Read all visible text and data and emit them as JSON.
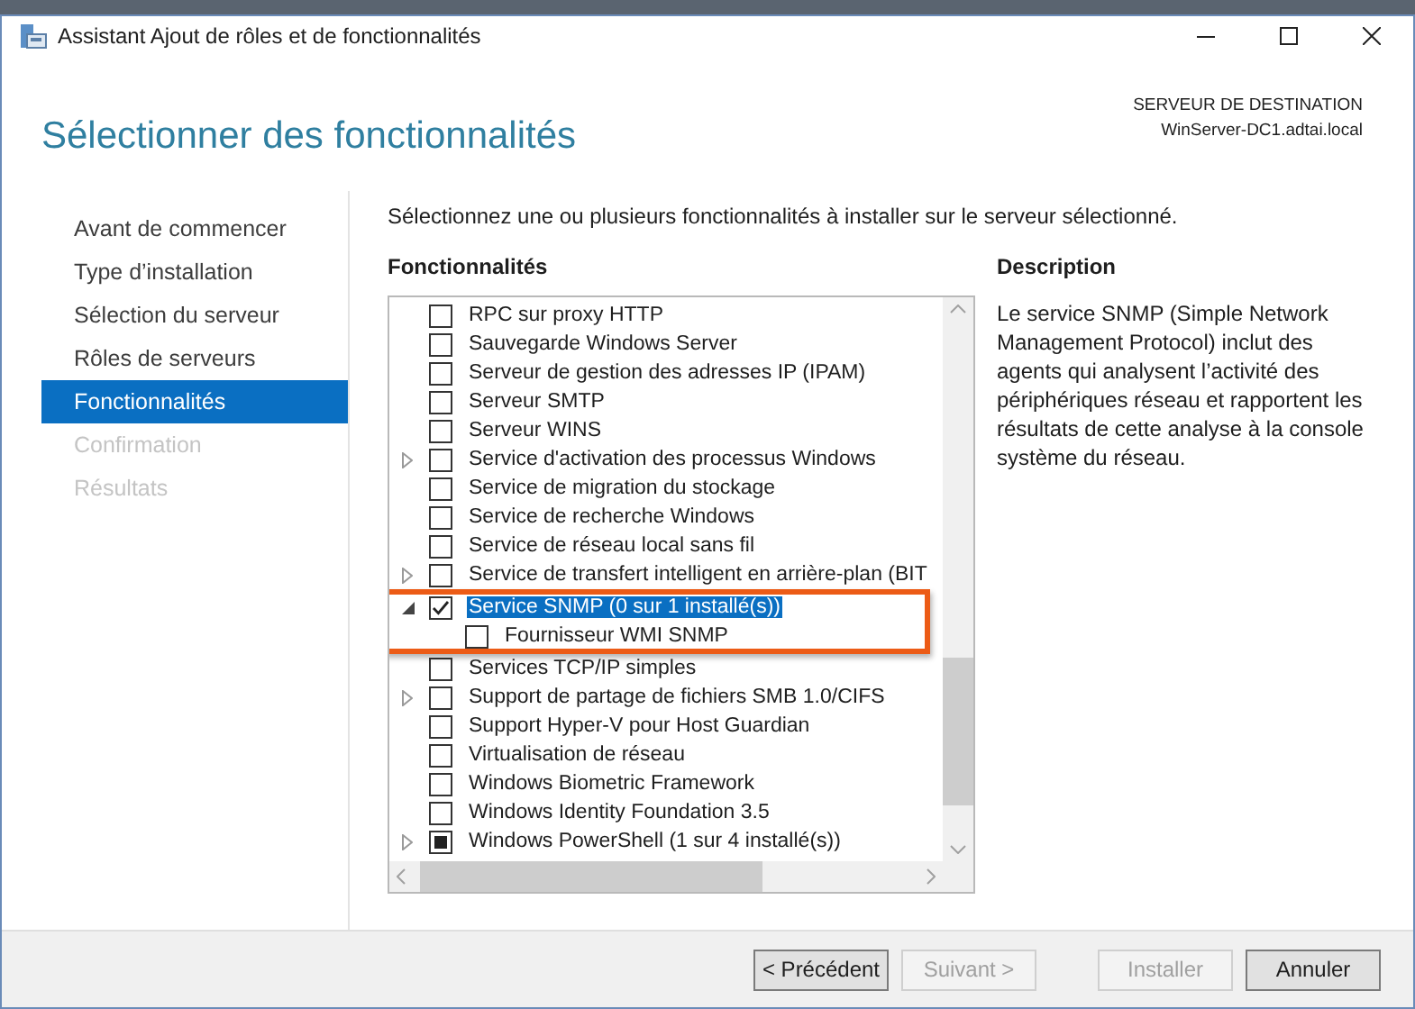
{
  "window": {
    "title": "Assistant Ajout de rôles et de fonctionnalités"
  },
  "header": {
    "title": "Sélectionner des fonctionnalités",
    "destination_label": "SERVEUR DE DESTINATION",
    "destination_server": "WinServer-DC1.adtai.local"
  },
  "nav": [
    {
      "label": "Avant de commencer",
      "selected": false,
      "disabled": false
    },
    {
      "label": "Type d’installation",
      "selected": false,
      "disabled": false
    },
    {
      "label": "Sélection du serveur",
      "selected": false,
      "disabled": false
    },
    {
      "label": "Rôles de serveurs",
      "selected": false,
      "disabled": false
    },
    {
      "label": "Fonctionnalités",
      "selected": true,
      "disabled": false
    },
    {
      "label": "Confirmation",
      "selected": false,
      "disabled": true
    },
    {
      "label": "Résultats",
      "selected": false,
      "disabled": true
    }
  ],
  "instruction": "Sélectionnez une ou plusieurs fonctionnalités à installer sur le serveur sélectionné.",
  "features_heading": "Fonctionnalités",
  "features": [
    {
      "label": "RPC sur proxy HTTP",
      "checked": false,
      "selected": false
    },
    {
      "label": "Sauvegarde Windows Server",
      "checked": false,
      "selected": false
    },
    {
      "label": "Serveur de gestion des adresses IP (IPAM)",
      "checked": false,
      "selected": false
    },
    {
      "label": "Serveur SMTP",
      "checked": false,
      "selected": false
    },
    {
      "label": "Serveur WINS",
      "checked": false,
      "selected": false
    },
    {
      "label": "Service d'activation des processus Windows",
      "checked": false,
      "expanded": false,
      "selected": false
    },
    {
      "label": "Service de migration du stockage",
      "checked": false,
      "selected": false
    },
    {
      "label": "Service de recherche Windows",
      "checked": false,
      "selected": false
    },
    {
      "label": "Service de réseau local sans fil",
      "checked": false,
      "selected": false
    },
    {
      "label": "Service de transfert intelligent en arrière-plan (BIT",
      "checked": false,
      "expanded": false,
      "selected": false
    },
    {
      "label": "Service SNMP (0 sur 1 installé(s))",
      "checked": true,
      "expanded": true,
      "selected": true,
      "highlighted": true,
      "children": [
        {
          "label": "Fournisseur WMI SNMP",
          "checked": false,
          "selected": false
        }
      ]
    },
    {
      "label": "Services TCP/IP simples",
      "checked": false,
      "selected": false
    },
    {
      "label": "Support de partage de fichiers SMB 1.0/CIFS",
      "checked": false,
      "expanded": false,
      "selected": false
    },
    {
      "label": "Support Hyper-V pour Host Guardian",
      "checked": false,
      "selected": false
    },
    {
      "label": "Virtualisation de réseau",
      "checked": false,
      "selected": false
    },
    {
      "label": "Windows Biometric Framework",
      "checked": false,
      "selected": false
    },
    {
      "label": "Windows Identity Foundation 3.5",
      "checked": false,
      "selected": false
    },
    {
      "label": "Windows PowerShell (1 sur 4 installé(s))",
      "checked": false,
      "partial": true,
      "expanded": false,
      "selected": false
    }
  ],
  "description_heading": "Description",
  "description": "Le service SNMP (Simple Network Management Protocol) inclut des agents qui analysent l’activité des périphériques réseau et rapportent les résultats de cette analyse à la console système du réseau.",
  "buttons": [
    {
      "label": "< Précédent",
      "disabled": false
    },
    {
      "label": "Suivant >",
      "disabled": true
    },
    {
      "label": "Installer",
      "disabled": true
    },
    {
      "label": "Annuler",
      "disabled": false
    }
  ]
}
